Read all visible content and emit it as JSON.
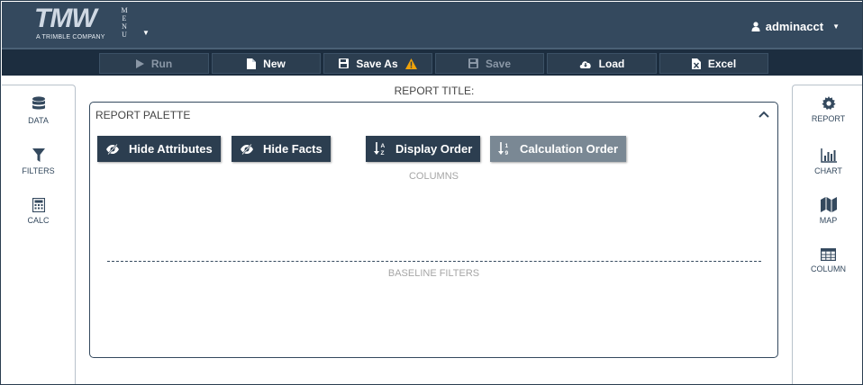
{
  "header": {
    "logo_text": "TMW",
    "logo_tagline": "A TRIMBLE COMPANY",
    "menu_label": [
      "M",
      "E",
      "N",
      "U"
    ],
    "user_name": "adminacct"
  },
  "toolbar": {
    "run": "Run",
    "new": "New",
    "save_as": "Save As",
    "save": "Save",
    "load": "Load",
    "excel": "Excel"
  },
  "left_sidebar": {
    "data": "DATA",
    "filters": "FILTERS",
    "calc": "CALC"
  },
  "right_sidebar": {
    "report": "REPORT",
    "chart": "CHART",
    "map": "MAP",
    "column": "COLUMN"
  },
  "main": {
    "report_title": "REPORT TITLE:",
    "palette_title": "REPORT PALETTE",
    "hide_attributes": "Hide Attributes",
    "hide_facts": "Hide Facts",
    "display_order": "Display Order",
    "calculation_order": "Calculation Order",
    "columns_label": "COLUMNS",
    "baseline_filters_label": "BASELINE FILTERS"
  },
  "colors": {
    "header_bg": "#34495e",
    "toolbar_bg": "#1c2d3f",
    "button_dark": "#2c3e50",
    "button_light": "#7a8894",
    "warning": "#f0a30a"
  }
}
